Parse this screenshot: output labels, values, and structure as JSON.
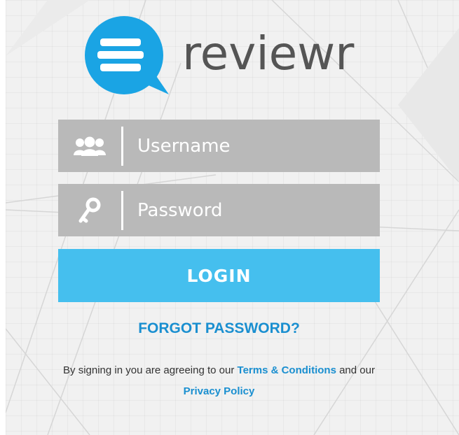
{
  "brand": {
    "name": "reviewr",
    "accent": "#1aa4e4",
    "text_color": "#555555"
  },
  "login_form": {
    "username_placeholder": "Username",
    "password_placeholder": "Password",
    "username_icon": "users-icon",
    "password_icon": "key-icon",
    "field_color": "#b9b9b9",
    "login_label": "LOGIN",
    "login_color": "#45bfee"
  },
  "forgot_password": {
    "label": "FORGOT PASSWORD?",
    "color": "#1a8fd0"
  },
  "terms": {
    "prefix": "By signing in you are agreeing to our",
    "terms_link": "Terms & Conditions",
    "middle": "and our",
    "privacy_link": "Privacy Policy"
  }
}
